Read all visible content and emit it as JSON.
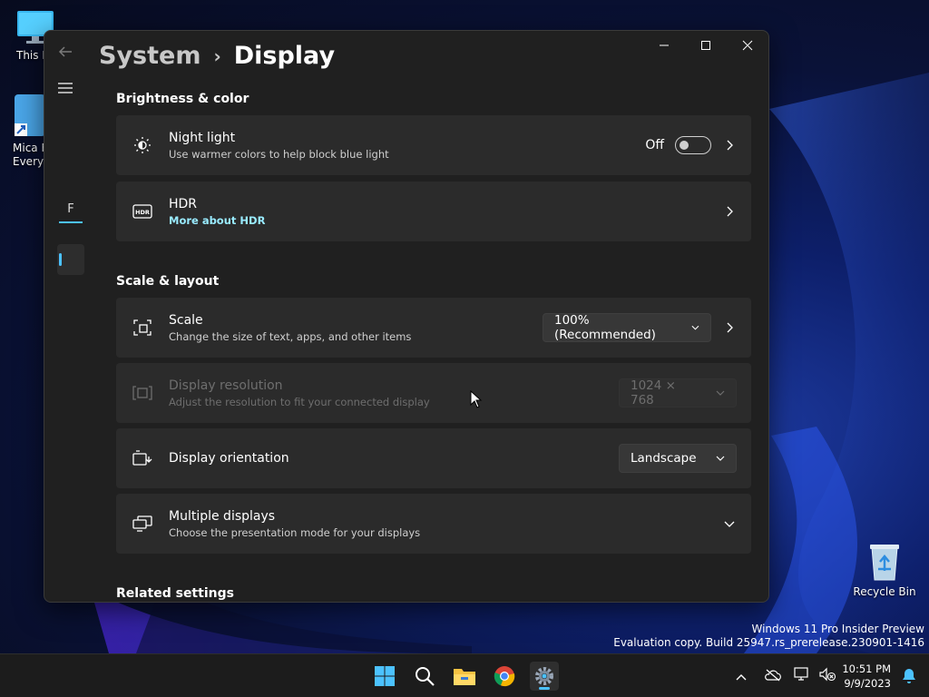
{
  "desktop": {
    "icons": [
      {
        "label": "This P"
      },
      {
        "label": "Mica F\nEveryo"
      },
      {
        "label": "Recycle Bin"
      }
    ],
    "watermark_line1": "Windows 11 Pro Insider Preview",
    "watermark_line2": "Evaluation copy. Build 25947.rs_prerelease.230901-1416"
  },
  "window": {
    "breadcrumb_parent": "System",
    "breadcrumb_separator": "›",
    "breadcrumb_current": "Display",
    "rail_box_letter": "F",
    "accent": "#4cc2ff"
  },
  "sections": {
    "brightness_title": "Brightness & color",
    "scale_title": "Scale & layout",
    "related_title": "Related settings"
  },
  "settings": {
    "night_light": {
      "title": "Night light",
      "subtitle": "Use warmer colors to help block blue light",
      "state_label": "Off"
    },
    "hdr": {
      "title": "HDR",
      "link": "More about HDR"
    },
    "scale": {
      "title": "Scale",
      "subtitle": "Change the size of text, apps, and other items",
      "value": "100% (Recommended)"
    },
    "resolution": {
      "title": "Display resolution",
      "subtitle": "Adjust the resolution to fit your connected display",
      "value": "1024 × 768"
    },
    "orientation": {
      "title": "Display orientation",
      "value": "Landscape"
    },
    "multiple": {
      "title": "Multiple displays",
      "subtitle": "Choose the presentation mode for your displays"
    }
  },
  "taskbar": {
    "time": "10:51 PM",
    "date": "9/9/2023"
  }
}
